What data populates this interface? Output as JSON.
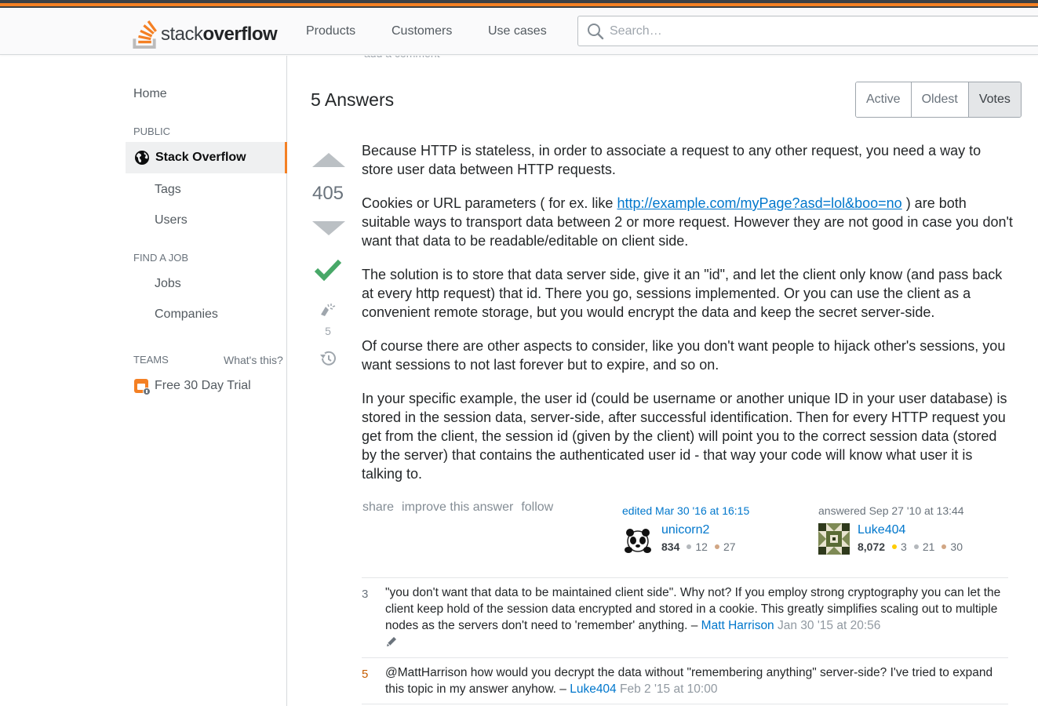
{
  "header": {
    "logo_light": "stack",
    "logo_bold": "overflow",
    "nav": [
      "Products",
      "Customers",
      "Use cases"
    ],
    "search_placeholder": "Search…"
  },
  "sidebar": {
    "home": "Home",
    "public_heading": "PUBLIC",
    "active_item": "Stack Overflow",
    "public_items": [
      "Tags",
      "Users"
    ],
    "job_heading": "FIND A JOB",
    "job_items": [
      "Jobs",
      "Companies"
    ],
    "teams_heading": "TEAMS",
    "teams_help": "What's this?",
    "teams_trial": "Free 30 Day Trial"
  },
  "main": {
    "faded_comment": "add a comment",
    "answers_title": "5 Answers",
    "sort_tabs": [
      "Active",
      "Oldest",
      "Votes"
    ],
    "active_sort": "Votes"
  },
  "answer": {
    "votes": "405",
    "accepted": true,
    "bounty_count": "5",
    "paragraphs": {
      "p1": "Because HTTP is stateless, in order to associate a request to any other request, you need a way to store user data between HTTP requests.",
      "p2_before": "Cookies or URL parameters ( for ex. like ",
      "p2_link": "http://example.com/myPage?asd=lol&boo=no",
      "p2_after": " ) are both suitable ways to transport data between 2 or more request. However they are not good in case you don't want that data to be readable/editable on client side.",
      "p3": "The solution is to store that data server side, give it an \"id\", and let the client only know (and pass back at every http request) that id. There you go, sessions implemented. Or you can use the client as a convenient remote storage, but you would encrypt the data and keep the secret server-side.",
      "p4": "Of course there are other aspects to consider, like you don't want people to hijack other's sessions, you want sessions to not last forever but to expire, and so on.",
      "p5": "In your specific example, the user id (could be username or another unique ID in your user database) is stored in the session data, server-side, after successful identification. Then for every HTTP request you get from the client, the session id (given by the client) will point you to the correct session data (stored by the server) that contains the authenticated user id - that way your code will know what user it is talking to."
    },
    "menu": [
      "share",
      "improve this answer",
      "follow"
    ],
    "editor": {
      "action": "edited Mar 30 '16 at 16:15",
      "name": "unicorn2",
      "rep": "834",
      "silver": "12",
      "bronze": "27"
    },
    "author": {
      "action": "answered Sep 27 '10 at 13:44",
      "name": "Luke404",
      "rep": "8,072",
      "gold": "3",
      "silver": "21",
      "bronze": "30"
    }
  },
  "comments": [
    {
      "score": "3",
      "text": "\"you don't want that data to be maintained client side\". Why not? If you employ strong cryptography you can let the client keep hold of the session data encrypted and stored in a cookie. This greatly simplifies scaling out to multiple nodes as the servers don't need to 'remember' anything. –",
      "user": "Matt Harrison",
      "date": "Jan 30 '15 at 20:56"
    },
    {
      "score": "5",
      "text": "@MattHarrison how would you decrypt the data without \"remembering anything\" server-side? I've tried to expand this topic in my answer anyhow. –",
      "user": "Luke404",
      "date": "Feb 2 '15 at 10:00"
    }
  ],
  "colors": {
    "accent": "#f48024",
    "link": "#0077cc",
    "accepted": "#48a868",
    "gold": "#ffcc01",
    "silver": "#b4b8bc",
    "bronze": "#d1a684"
  }
}
